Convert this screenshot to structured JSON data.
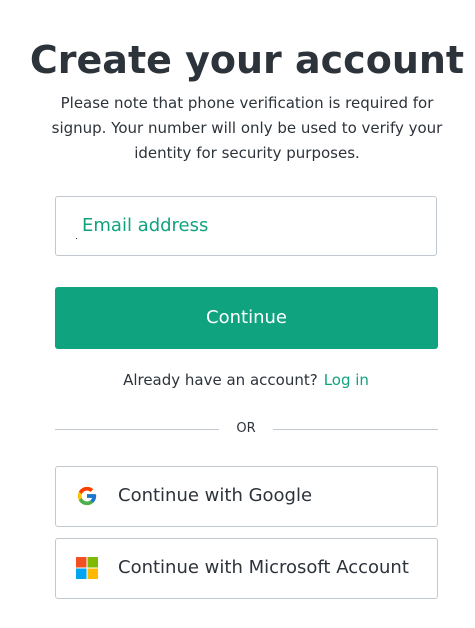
{
  "header": {
    "title": "Create your account",
    "subtitle": "Please note that phone verification is required for signup. Your number will only be used to verify your identity for security purposes."
  },
  "form": {
    "email_label": "Email address",
    "email_value": "",
    "continue_label": "Continue"
  },
  "login": {
    "prompt": "Already have an account?",
    "link_label": "Log in"
  },
  "divider": {
    "text": "OR"
  },
  "social": {
    "google_label": "Continue with Google",
    "google_icon": "google-icon",
    "microsoft_label": "Continue with Microsoft Account",
    "microsoft_icon": "microsoft-icon"
  },
  "colors": {
    "accent": "#10a37f",
    "text": "#2d333a",
    "border": "#c2c8d0"
  }
}
